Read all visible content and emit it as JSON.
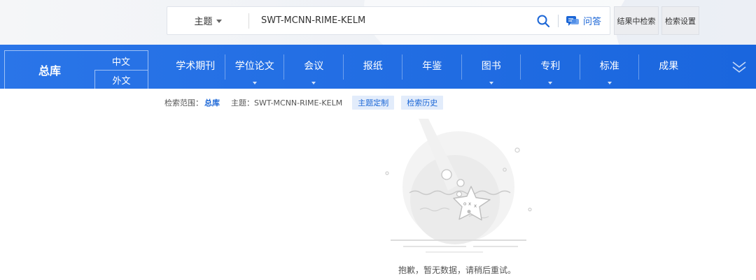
{
  "search": {
    "field_label": "主题",
    "query": "SWT-MCNN-RIME-KELM",
    "qa_label": "问答"
  },
  "buttons": {
    "search_in_results": "结果中检索",
    "search_settings": "检索设置"
  },
  "nav": {
    "total_label": "总库",
    "lang_zh": "中文",
    "lang_foreign": "外文",
    "items": [
      {
        "label": "学术期刊",
        "has_menu": false
      },
      {
        "label": "学位论文",
        "has_menu": true
      },
      {
        "label": "会议",
        "has_menu": true
      },
      {
        "label": "报纸",
        "has_menu": false
      },
      {
        "label": "年鉴",
        "has_menu": false
      },
      {
        "label": "图书",
        "has_menu": true
      },
      {
        "label": "专利",
        "has_menu": true
      },
      {
        "label": "标准",
        "has_menu": true
      },
      {
        "label": "成果",
        "has_menu": false
      }
    ]
  },
  "scope": {
    "prefix": "检索范围：",
    "total": "总库",
    "topic": "主题：SWT-MCNN-RIME-KELM",
    "chip_custom": "主题定制",
    "chip_history": "检索历史"
  },
  "empty_state": {
    "message": "抱歉，暂无数据，请稍后重试。"
  },
  "colors": {
    "nav_blue": "#1a66de",
    "link_blue": "#1b66d6",
    "chip_bg": "#e2ecfb"
  }
}
